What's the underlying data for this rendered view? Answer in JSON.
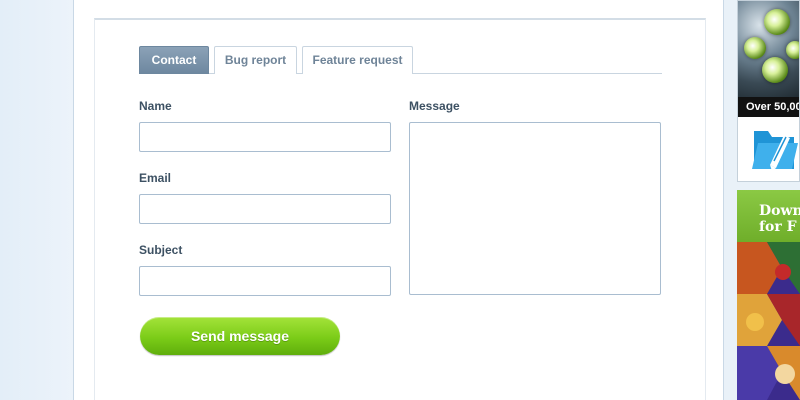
{
  "tabs": [
    {
      "label": "Contact",
      "active": true
    },
    {
      "label": "Bug report",
      "active": false
    },
    {
      "label": "Feature request",
      "active": false
    }
  ],
  "form": {
    "name_label": "Name",
    "name_value": "",
    "email_label": "Email",
    "email_value": "",
    "subject_label": "Subject",
    "subject_value": "",
    "message_label": "Message",
    "message_value": "",
    "submit_label": "Send message"
  },
  "ads": {
    "top_banner_text": "Over 50,00",
    "bottom_heading_line1": "Down",
    "bottom_heading_line2": "for F",
    "top_icon": "folder-pencil-icon"
  },
  "colors": {
    "active_tab": "#7891a8",
    "submit_button": "#7bcc18",
    "field_border": "#a9bdd0",
    "label_text": "#3d5163"
  }
}
